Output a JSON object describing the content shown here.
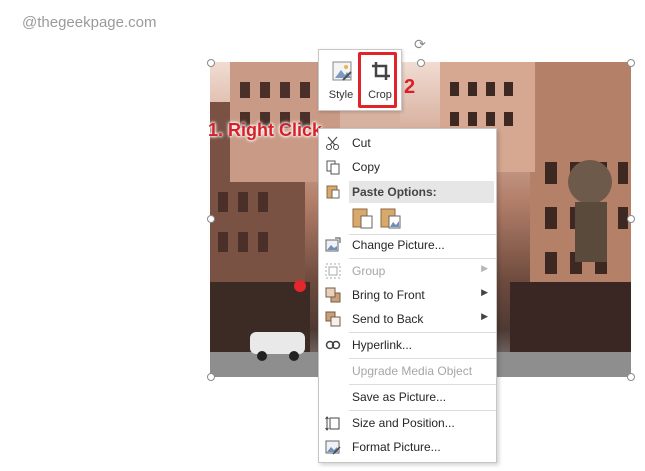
{
  "watermark": "@thegeekpage.com",
  "annotations": {
    "step1": "1. Right Click",
    "step2": "2",
    "accent_color": "#e1232a"
  },
  "mini_toolbar": {
    "style_label": "Style",
    "crop_label": "Crop"
  },
  "context_menu": {
    "cut": "Cut",
    "copy": "Copy",
    "paste_options": "Paste Options:",
    "change_picture": "Change Picture...",
    "group": "Group",
    "bring_to_front": "Bring to Front",
    "send_to_back": "Send to Back",
    "hyperlink": "Hyperlink...",
    "upgrade_media": "Upgrade Media Object",
    "save_as_picture": "Save as Picture...",
    "size_position": "Size and Position...",
    "format_picture": "Format Picture...",
    "submenu_arrow": "▶"
  },
  "icons": {
    "cut": "scissors-icon",
    "copy": "copy-icon",
    "paste": "clipboard-icon",
    "change_picture": "change-picture-icon",
    "group": "group-icon",
    "bring_to_front": "bring-to-front-icon",
    "send_to_back": "send-to-back-icon",
    "hyperlink": "link-icon",
    "size_position": "size-position-icon",
    "format_picture": "format-picture-icon",
    "rotate": "rotate-handle-icon"
  }
}
